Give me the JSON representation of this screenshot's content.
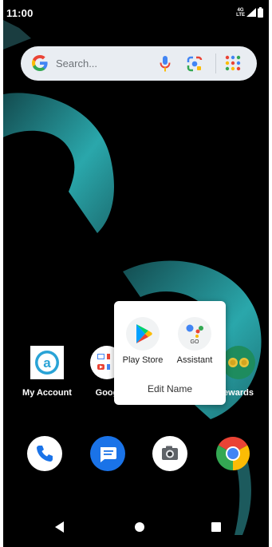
{
  "status_bar": {
    "time": "11:00",
    "network_top": "4G",
    "network_bottom": "LTE"
  },
  "search": {
    "placeholder": "Search..."
  },
  "home_apps": [
    {
      "label": "My Account"
    },
    {
      "label": "Goog"
    },
    {
      "label": "ewards"
    }
  ],
  "context_menu": {
    "items": [
      {
        "label": "Play Store"
      },
      {
        "label": "Assistant"
      }
    ],
    "assistant_badge": "GO",
    "edit_name": "Edit Name"
  },
  "colors": {
    "wallpaper_accent": "#2fb3b6",
    "search_bg": "#e9edf2",
    "phone": "#1a73e8",
    "messages": "#1a73e8"
  }
}
